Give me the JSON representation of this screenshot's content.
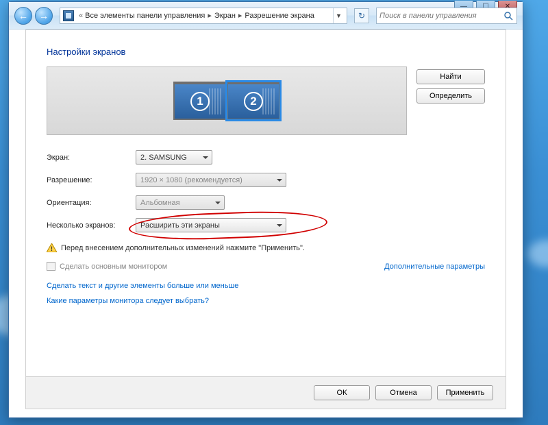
{
  "chrome": {
    "minimize": "—",
    "maximize": "☐",
    "close": "✕"
  },
  "nav": {
    "back": "←",
    "forward": "→",
    "chevrons": "«",
    "crumb1": "Все элементы панели управления",
    "crumb2": "Экран",
    "crumb3": "Разрешение экрана",
    "search_placeholder": "Поиск в панели управления"
  },
  "page": {
    "title": "Настройки экранов",
    "monitor1": "1",
    "monitor2": "2",
    "find_btn": "Найти",
    "detect_btn": "Определить"
  },
  "form": {
    "screen_label": "Экран:",
    "screen_value": "2. SAMSUNG",
    "res_label": "Разрешение:",
    "res_value": "1920 × 1080 (рекомендуется)",
    "orient_label": "Ориентация:",
    "orient_value": "Альбомная",
    "multi_label": "Несколько экранов:",
    "multi_value": "Расширить эти экраны"
  },
  "warn": "Перед внесением дополнительных изменений нажмите \"Применить\".",
  "checkbox": {
    "label": "Сделать основным монитором",
    "adv_link": "Дополнительные параметры"
  },
  "links": {
    "text_size": "Сделать текст и другие элементы больше или меньше",
    "which": "Какие параметры монитора следует выбрать?"
  },
  "buttons": {
    "ok": "ОК",
    "cancel": "Отмена",
    "apply": "Применить"
  }
}
